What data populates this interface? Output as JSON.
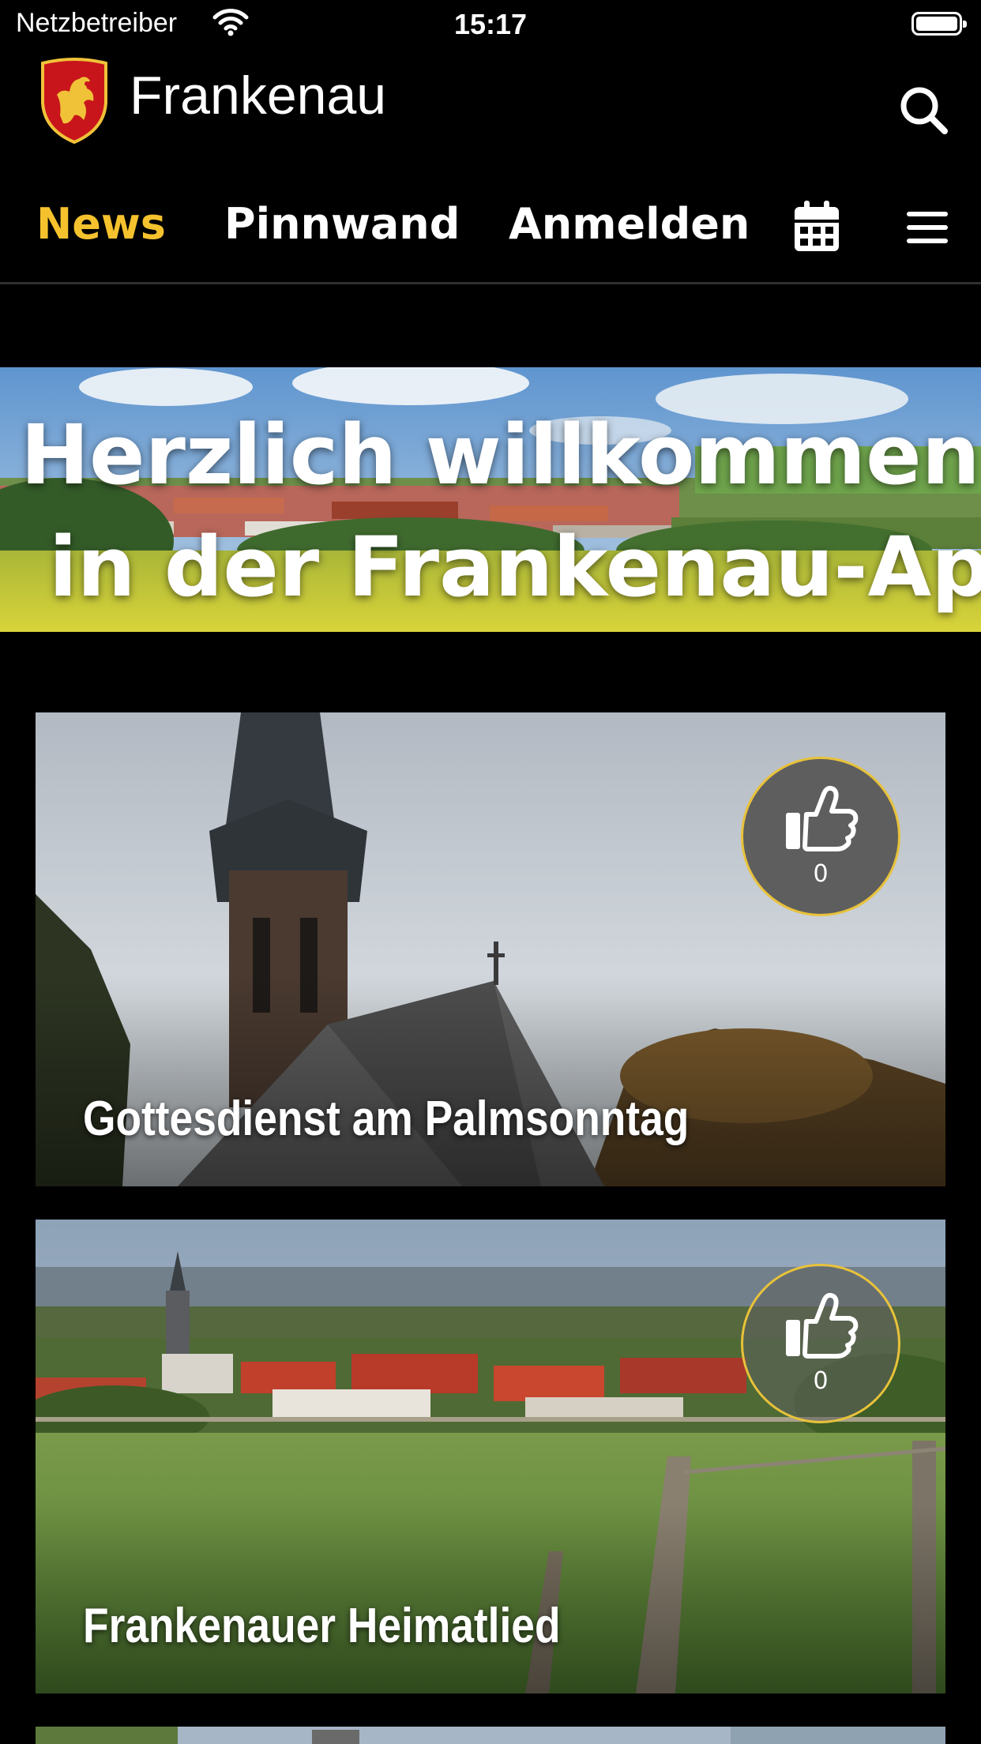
{
  "status_bar": {
    "carrier": "Netzbetreiber",
    "time": "15:17"
  },
  "header": {
    "title": "Frankenau"
  },
  "nav": {
    "tabs": [
      "News",
      "Pinnwand",
      "Anmelden"
    ],
    "active_color": "#f5c22e"
  },
  "banner": {
    "line1": "Herzlich willkommen",
    "line2": "in der Frankenau-App!"
  },
  "cards": [
    {
      "title": "Gottesdienst am Palmsonntag",
      "likes": "0"
    },
    {
      "title": "Frankenauer Heimatlied",
      "likes": "0"
    }
  ],
  "icons": [
    "wifi-icon",
    "battery-icon",
    "coat-of-arms-logo",
    "search-icon",
    "calendar-icon",
    "hamburger-menu-icon",
    "thumbs-up-icon"
  ]
}
